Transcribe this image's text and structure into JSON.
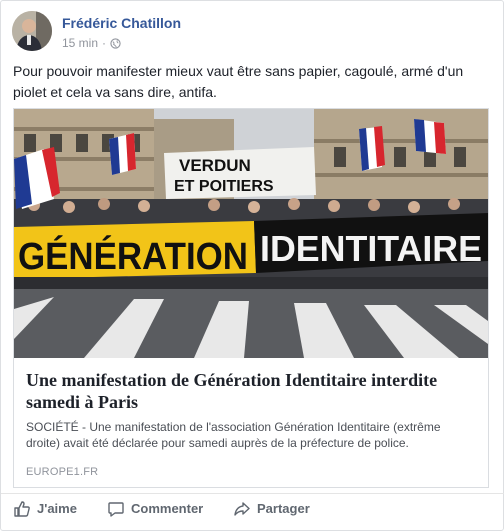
{
  "post": {
    "author": "Frédéric Chatillon",
    "time": "15 min",
    "separator": "·",
    "privacy_icon": "globe-icon",
    "text": "Pour pouvoir manifester mieux vaut être sans papier, cagoulé, armé d'un piolet et cela va sans dire, antifa."
  },
  "card": {
    "image": {
      "banner_text_left": "GÉNÉRATION",
      "banner_text_right": "IDENTITAIRE",
      "sign_line1": "VERDUN",
      "sign_line2": "ET POITIERS"
    },
    "title": "Une manifestation de Génération Identitaire interdite samedi à Paris",
    "description": "SOCIÉTÉ - Une manifestation de l'association Génération Identitaire (extrême droite) avait été déclarée pour samedi auprès de la préfecture de police.",
    "domain": "EUROPE1.FR"
  },
  "actions": {
    "like_label": "J'aime",
    "comment_label": "Commenter",
    "share_label": "Partager",
    "like_icon": "thumbs-up-icon",
    "comment_icon": "comment-icon",
    "share_icon": "share-icon"
  },
  "colors": {
    "author": "#365899",
    "muted": "#90949c",
    "text": "#1d2129",
    "action": "#606770",
    "banner_yellow": "#f2c418",
    "banner_black": "#111111"
  }
}
